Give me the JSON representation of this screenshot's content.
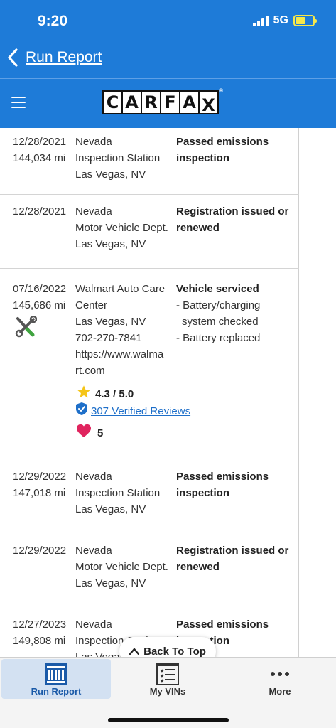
{
  "status_bar": {
    "time": "9:20",
    "network": "5G"
  },
  "nav": {
    "back_label": "Run Report"
  },
  "header": {
    "logo_letters": [
      "C",
      "A",
      "R",
      "F",
      "A",
      "X"
    ],
    "logo_trademark": "®"
  },
  "records": [
    {
      "date": "12/28/2021",
      "mileage": "144,034 mi",
      "source": [
        "Nevada",
        "Inspection Station",
        "Las Vegas, NV"
      ],
      "title": [
        "Passed emissions",
        "inspection"
      ],
      "details": []
    },
    {
      "date": "12/28/2021",
      "mileage": "",
      "source": [
        "Nevada",
        "Motor Vehicle Dept.",
        "Las Vegas, NV"
      ],
      "title": [
        "Registration issued or",
        "renewed"
      ],
      "details": []
    },
    {
      "date": "07/16/2022",
      "mileage": "145,686 mi",
      "source": [
        "Walmart Auto Care",
        "Center",
        "Las Vegas, NV",
        "702-270-7841",
        "https://www.walma",
        "rt.com"
      ],
      "title": [
        "Vehicle serviced"
      ],
      "details": [
        "- Battery/charging",
        "system checked",
        "- Battery replaced"
      ],
      "rating": "4.3 / 5.0",
      "reviews": "307 Verified Reviews",
      "favorites": "5"
    },
    {
      "date": "12/29/2022",
      "mileage": "147,018 mi",
      "source": [
        "Nevada",
        "Inspection Station",
        "Las Vegas, NV"
      ],
      "title": [
        "Passed emissions",
        "inspection"
      ],
      "details": []
    },
    {
      "date": "12/29/2022",
      "mileage": "",
      "source": [
        "Nevada",
        "Motor Vehicle Dept.",
        "Las Vegas, NV"
      ],
      "title": [
        "Registration issued or",
        "renewed"
      ],
      "details": []
    },
    {
      "date": "12/27/2023",
      "mileage": "149,808 mi",
      "source": [
        "Nevada",
        "Inspection Station",
        "Las Vegas, NV"
      ],
      "title": [
        "Passed emissions",
        "inspection"
      ],
      "details": []
    }
  ],
  "back_to_top": "Back To Top",
  "tabbar": {
    "tabs": [
      {
        "label": "Run Report",
        "icon": "run-report-icon",
        "active": true
      },
      {
        "label": "My VINs",
        "icon": "vin-list-icon",
        "active": false
      },
      {
        "label": "More",
        "icon": "more-dots-icon",
        "active": false
      }
    ]
  },
  "colors": {
    "brand_blue": "#1e7bd8",
    "link_blue": "#1e6fc9",
    "star": "#f5c518",
    "heart": "#e0245e",
    "active_tab_bg": "#d3e1f2"
  }
}
